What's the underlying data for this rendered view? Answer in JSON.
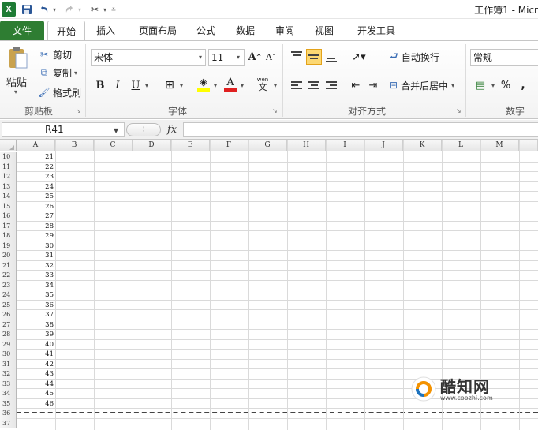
{
  "app": {
    "icon_letter": "X",
    "doc_title": "工作簿1 - Micr",
    "brand_color": "#2e7d32"
  },
  "quick_access": {
    "save_icon": "save-icon",
    "undo_icon": "undo-icon",
    "redo_icon": "redo-icon",
    "tool_icon": "tool-icon"
  },
  "tabs": [
    "文件",
    "开始",
    "插入",
    "页面布局",
    "公式",
    "数据",
    "审阅",
    "视图",
    "开发工具"
  ],
  "ribbon": {
    "clipboard": {
      "paste": "粘贴",
      "cut": "剪切",
      "copy": "复制",
      "painter": "格式刷",
      "group": "剪贴板"
    },
    "font": {
      "name": "宋体",
      "size": "11",
      "grow": "A",
      "shrink": "A",
      "bold": "B",
      "italic": "I",
      "underline": "U",
      "phonetic": "wén",
      "group": "字体",
      "fill_color": "#ffff00",
      "font_color": "#e02020"
    },
    "alignment": {
      "wrap": "自动换行",
      "merge": "合并后居中",
      "group": "对齐方式"
    },
    "number": {
      "format": "常规",
      "percent": "%",
      "comma": ",",
      "group": "数字"
    }
  },
  "formula_bar": {
    "name_box": "R41",
    "fx": "fx",
    "formula": ""
  },
  "sheet": {
    "columns": [
      "A",
      "B",
      "C",
      "D",
      "E",
      "F",
      "G",
      "H",
      "I",
      "J",
      "K",
      "L",
      "M"
    ],
    "selected_column": "R",
    "rows": [
      {
        "n": "10",
        "a": "21"
      },
      {
        "n": "11",
        "a": "22"
      },
      {
        "n": "12",
        "a": "23"
      },
      {
        "n": "13",
        "a": "24"
      },
      {
        "n": "14",
        "a": "25"
      },
      {
        "n": "15",
        "a": "26"
      },
      {
        "n": "16",
        "a": "27"
      },
      {
        "n": "17",
        "a": "28"
      },
      {
        "n": "18",
        "a": "29"
      },
      {
        "n": "19",
        "a": "30"
      },
      {
        "n": "20",
        "a": "31"
      },
      {
        "n": "21",
        "a": "32"
      },
      {
        "n": "22",
        "a": "33"
      },
      {
        "n": "23",
        "a": "34"
      },
      {
        "n": "24",
        "a": "35"
      },
      {
        "n": "25",
        "a": "36"
      },
      {
        "n": "26",
        "a": "37"
      },
      {
        "n": "27",
        "a": "38"
      },
      {
        "n": "28",
        "a": "39"
      },
      {
        "n": "29",
        "a": "40"
      },
      {
        "n": "30",
        "a": "41"
      },
      {
        "n": "31",
        "a": "42"
      },
      {
        "n": "32",
        "a": "43"
      },
      {
        "n": "33",
        "a": "44"
      },
      {
        "n": "34",
        "a": "45"
      },
      {
        "n": "35",
        "a": "46"
      },
      {
        "n": "36",
        "a": ""
      },
      {
        "n": "37",
        "a": ""
      }
    ]
  },
  "watermark": {
    "name": "酷知网",
    "url": "www.coozhi.com"
  }
}
